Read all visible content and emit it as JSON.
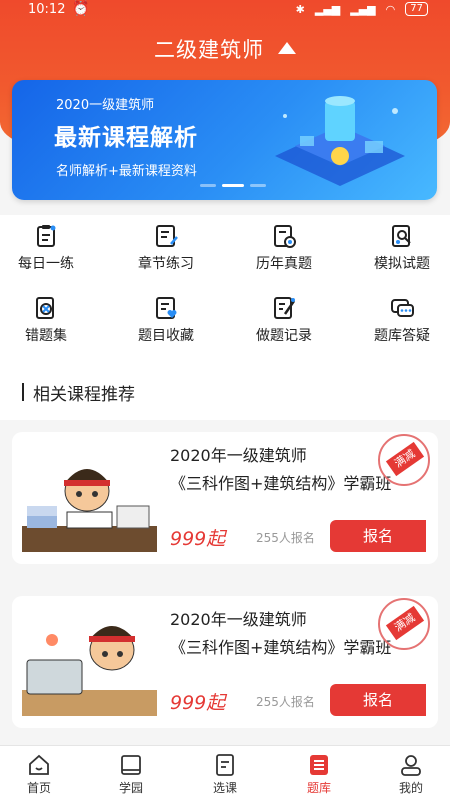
{
  "status": {
    "time": "10:12",
    "battery": "77"
  },
  "header": {
    "title": "二级建筑师"
  },
  "banner": {
    "line1": "2020一级建筑师",
    "line2": "最新课程解析",
    "line3": "名师解析+最新课程资料"
  },
  "grid": [
    {
      "label": "每日一练",
      "icon": "daily-practice-icon"
    },
    {
      "label": "章节练习",
      "icon": "chapter-practice-icon"
    },
    {
      "label": "历年真题",
      "icon": "past-exams-icon"
    },
    {
      "label": "模拟试题",
      "icon": "mock-exam-icon"
    },
    {
      "label": "错题集",
      "icon": "wrong-questions-icon"
    },
    {
      "label": "题目收藏",
      "icon": "favorites-icon"
    },
    {
      "label": "做题记录",
      "icon": "practice-record-icon"
    },
    {
      "label": "题库答疑",
      "icon": "qa-icon"
    }
  ],
  "section": {
    "title": "相关课程推荐"
  },
  "courses": [
    {
      "title": "2020年一级建筑师",
      "subtitle": "《三科作图+建筑结构》学霸班",
      "price": "999起",
      "count": "255人报名",
      "button": "报名",
      "stamp": "满减"
    },
    {
      "title": "2020年一级建筑师",
      "subtitle": "《三科作图+建筑结构》学霸班",
      "price": "999起",
      "count": "255人报名",
      "button": "报名",
      "stamp": "满减"
    }
  ],
  "tabs": [
    {
      "label": "首页",
      "icon": "home-icon"
    },
    {
      "label": "学园",
      "icon": "book-icon"
    },
    {
      "label": "选课",
      "icon": "course-select-icon"
    },
    {
      "label": "题库",
      "icon": "question-bank-icon",
      "active": true
    },
    {
      "label": "我的",
      "icon": "profile-icon"
    }
  ],
  "colors": {
    "accent": "#e53935",
    "header": "#ef4a2c",
    "banner": "#2a8ef5"
  }
}
